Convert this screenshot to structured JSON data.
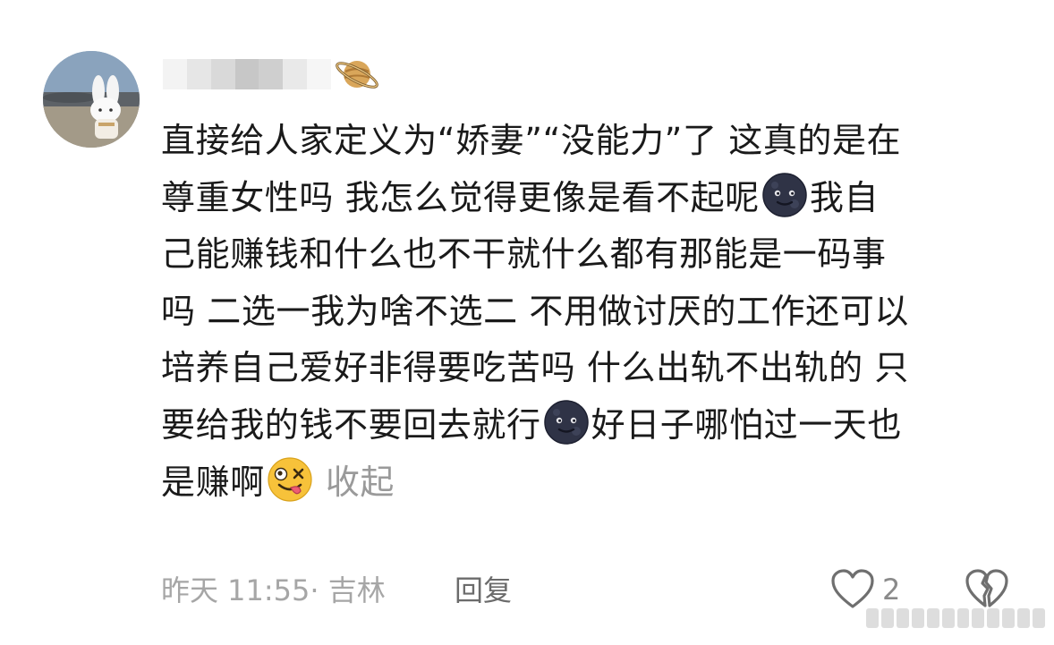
{
  "comment": {
    "avatar_icon": "rabbit-plush-avatar",
    "username_state": "blurred",
    "badge_icon": "saturn-planet-icon",
    "lines": [
      {
        "segments": [
          {
            "text": "直接给人家定义为“娇妻”“没能力”了 这真的是在"
          }
        ]
      },
      {
        "segments": [
          {
            "text": "尊重女性吗 我怎么觉得更像是看不起呢"
          },
          {
            "emoji": "dark-moon-face-emoji"
          },
          {
            "text": "我自"
          }
        ]
      },
      {
        "segments": [
          {
            "text": "己能赚钱和什么也不干就什么都有那能是一码事"
          }
        ]
      },
      {
        "segments": [
          {
            "text": "吗 二选一我为啥不选二 不用做讨厌的工作还可以"
          }
        ]
      },
      {
        "segments": [
          {
            "text": "培养自己爱好非得要吃苦吗 什么出轨不出轨的 只"
          }
        ]
      },
      {
        "segments": [
          {
            "text": "要给我的钱不要回去就行"
          },
          {
            "emoji": "dark-moon-face-emoji"
          },
          {
            "text": "好日子哪怕过一天也"
          }
        ]
      },
      {
        "segments": [
          {
            "text": "是赚啊"
          },
          {
            "emoji": "zany-face-emoji"
          }
        ]
      }
    ],
    "collapse_label": "收起",
    "meta": "昨天 11:55· 吉林",
    "reply_label": "回复",
    "like_count": "2",
    "like_icon": "heart-outline-icon",
    "dislike_icon": "broken-heart-icon"
  }
}
